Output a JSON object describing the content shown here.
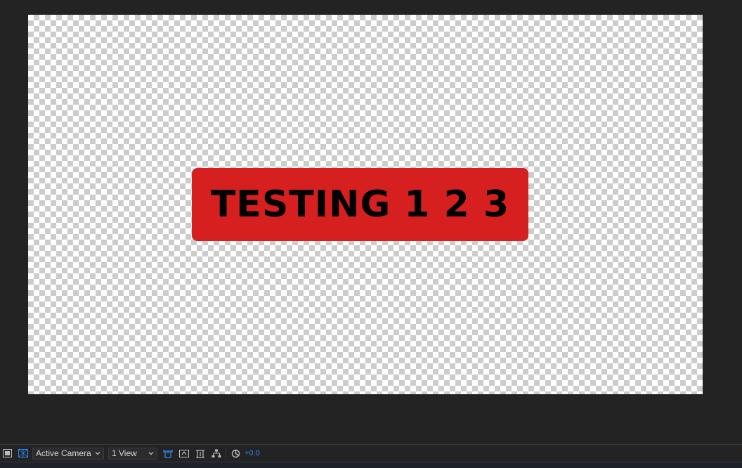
{
  "composition": {
    "lower_third_text": "TESTING 1 2 3",
    "lower_third_color": "#d61f1f",
    "text_color": "#000000"
  },
  "toolbar": {
    "icons": [
      "region-of-interest-icon",
      "transparency-grid-icon",
      "reset-view-icon",
      "snapshot-icon",
      "show-channel-icon",
      "flowchart-icon",
      "reset-exposure-icon"
    ],
    "camera_select": "Active Camera",
    "view_layout_select": "1 View",
    "exposure_value": "+0.0",
    "accent_color": "#2b8cff"
  }
}
